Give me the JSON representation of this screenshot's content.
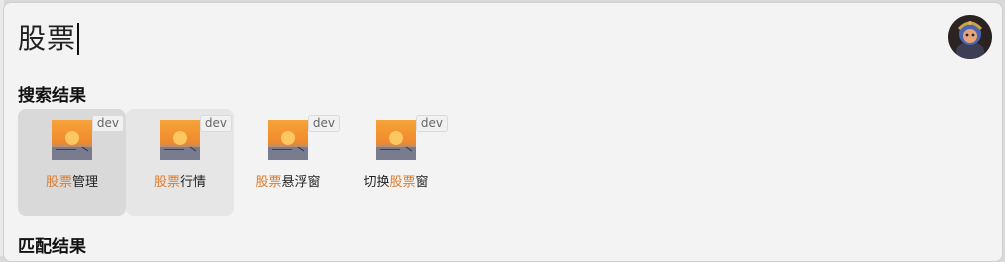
{
  "search": {
    "query": "股票"
  },
  "sections": {
    "search_results_title": "搜索结果",
    "match_results_title": "匹配结果"
  },
  "results": [
    {
      "highlight_before": "",
      "highlight": "股票",
      "after": "管理",
      "badge": "dev",
      "state": "selected"
    },
    {
      "highlight_before": "",
      "highlight": "股票",
      "after": "行情",
      "badge": "dev",
      "state": "hover"
    },
    {
      "highlight_before": "",
      "highlight": "股票",
      "after": "悬浮窗",
      "badge": "dev",
      "state": "normal"
    },
    {
      "highlight_before": "切换",
      "highlight": "股票",
      "after": "窗",
      "badge": "dev",
      "state": "normal"
    }
  ],
  "colors": {
    "highlight": "#e07a2a",
    "panel": "#f3f3f3",
    "selected": "#d9d9d9"
  },
  "icons": {
    "result_icon": "sunset-sea-thumbnail-icon",
    "avatar": "user-avatar"
  }
}
